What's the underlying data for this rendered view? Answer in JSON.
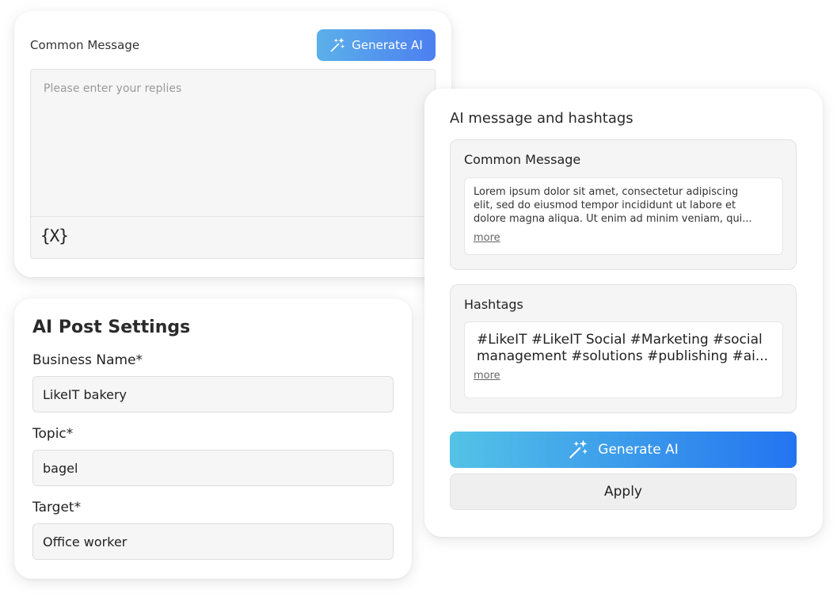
{
  "common_message_card": {
    "title": "Common Message",
    "generate_label": "Generate AI",
    "reply_placeholder": "Please enter your replies",
    "variable_button_label": "{X}"
  },
  "settings_card": {
    "heading": "AI Post Settings",
    "fields": [
      {
        "label": "Business Name*",
        "value": "LikeIT bakery"
      },
      {
        "label": "Topic*",
        "value": "bagel"
      },
      {
        "label": "Target*",
        "value": "Office worker"
      }
    ]
  },
  "ai_card": {
    "heading": "AI message and hashtags",
    "message_panel": {
      "title": "Common Message",
      "line1": "Lorem ipsum dolor sit amet, consectetur adipiscing",
      "line2": "elit, sed do eiusmod tempor incididunt ut labore et",
      "line3": "dolore magna aliqua. Ut enim ad minim veniam, qui...",
      "more_label": "more"
    },
    "hashtag_panel": {
      "title": "Hashtags",
      "line1": "#LikeIT #LikeIT Social #Marketing #social",
      "line2": "management #solutions #publishing #ai...",
      "more_label": "more"
    },
    "generate_label": "Generate AI",
    "apply_label": "Apply"
  },
  "colors": {
    "small_button_gradient": [
      "#5bb0ea",
      "#4d7ff0"
    ],
    "big_button_gradient": [
      "#54c3e6",
      "#2474f0"
    ],
    "panel_bg": "#f5f5f5"
  },
  "icons": {
    "generate": "magic-wand-icon"
  }
}
